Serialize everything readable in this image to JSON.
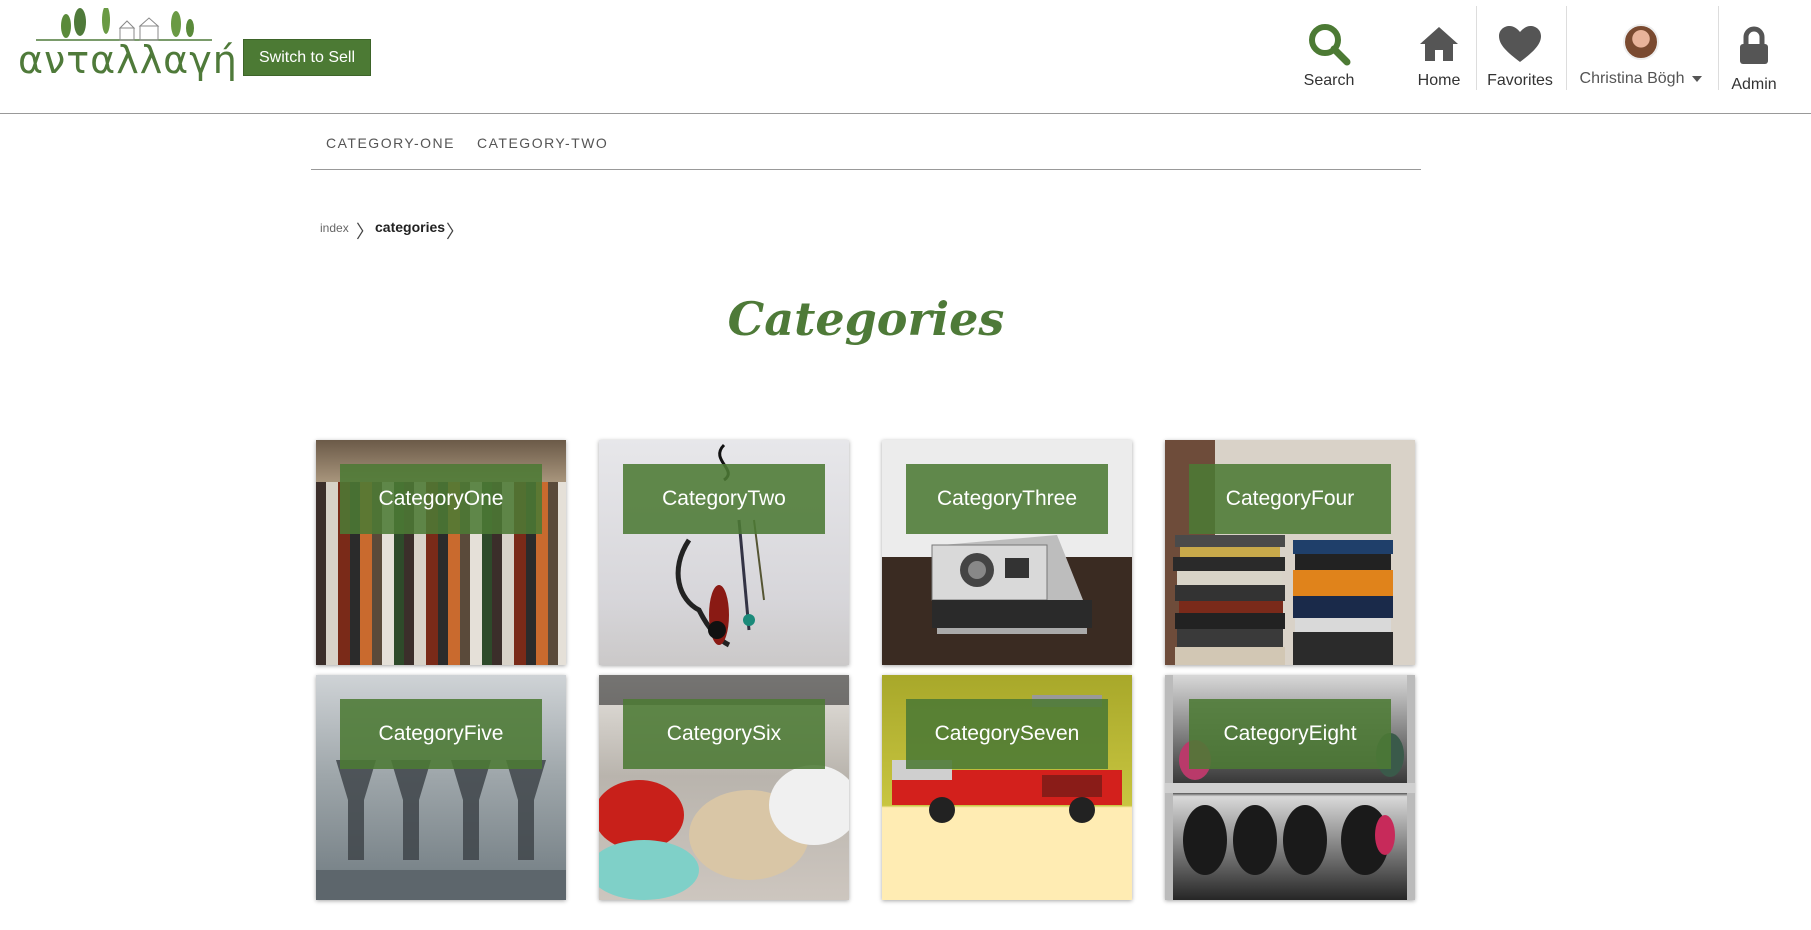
{
  "header": {
    "logo_text": "ανταλλαγή",
    "switch_label": "Switch to Sell",
    "nav": {
      "search": "Search",
      "home": "Home",
      "favorites": "Favorites",
      "user": "Christina Bögh",
      "admin": "Admin"
    }
  },
  "subnav": {
    "items": [
      "CATEGORY-ONE",
      "CATEGORY-TWO"
    ]
  },
  "breadcrumb": {
    "index": "index",
    "current": "categories"
  },
  "page": {
    "title": "Categories"
  },
  "categories": [
    {
      "label": "CategoryOne",
      "image": "clothes-rack"
    },
    {
      "label": "CategoryTwo",
      "image": "necklaces-on-wall"
    },
    {
      "label": "CategoryThree",
      "image": "polaroid-camera"
    },
    {
      "label": "CategoryFour",
      "image": "book-stacks"
    },
    {
      "label": "CategoryFive",
      "image": "glassware"
    },
    {
      "label": "CategorySix",
      "image": "pillows"
    },
    {
      "label": "CategorySeven",
      "image": "toy-fire-truck"
    },
    {
      "label": "CategoryEight",
      "image": "shoe-shelves"
    }
  ],
  "colors": {
    "brand_green": "#4c7a34",
    "title_green": "#4e7a38",
    "card_label_bg": "#4c7a34"
  }
}
